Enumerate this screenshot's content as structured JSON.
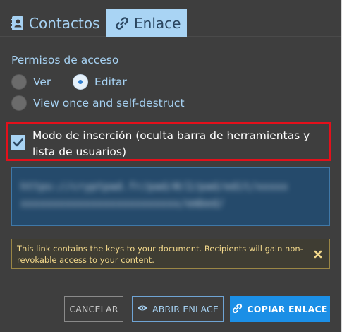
{
  "tabs": {
    "contacts_label": "Contactos",
    "link_label": "Enlace",
    "active": "Enlace"
  },
  "permissions": {
    "heading": "Permisos de acceso",
    "options": [
      {
        "label": "Ver",
        "selected": false
      },
      {
        "label": "Editar",
        "selected": true
      },
      {
        "label": "View once and self-destruct",
        "selected": false
      }
    ]
  },
  "embed_mode": {
    "label": "Modo de inserción (oculta barra de herramientas y lista de usuarios)",
    "checked": true
  },
  "link": {
    "value": "https://cryptpad.fr/pad/#/2/pad/edit/xxxxxxxxxxxxxxxxxxxxxxxxxxxxxx/embed/"
  },
  "warning": {
    "text": "This link contains the keys to your document. Recipients will gain non-revokable access to your content."
  },
  "buttons": {
    "cancel": "CANCELAR",
    "open": "ABRIR ENLACE",
    "copy": "COPIAR ENLACE"
  },
  "colors": {
    "accent": "#1b8fe6",
    "active_tab": "#a9d4f4",
    "highlight_border": "#e4101b",
    "warning_text": "#f2d88b"
  },
  "icons": {
    "contacts_tab": "address-book-icon",
    "link_tab": "link-icon",
    "warning_close": "close-icon",
    "open_button": "eye-icon",
    "copy_button": "link-icon"
  }
}
